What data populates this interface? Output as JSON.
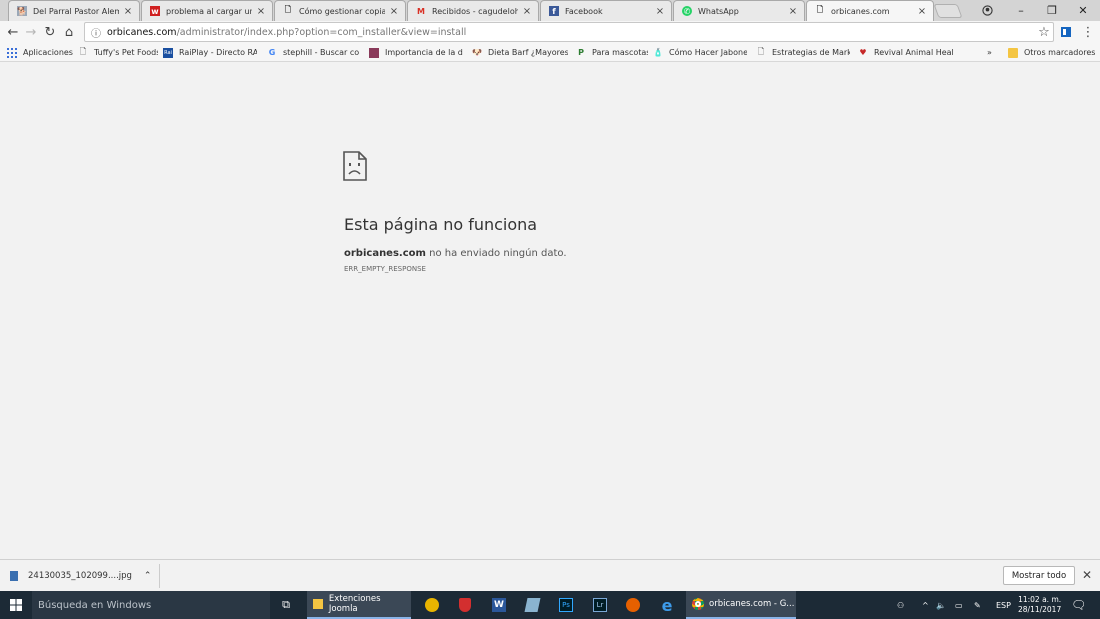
{
  "tabs": [
    {
      "title": "Del Parral Pastor Alemán",
      "icon": "dog-icon",
      "active": false
    },
    {
      "title": "problema al cargar un m",
      "icon": "w-icon",
      "active": false
    },
    {
      "title": "Cómo gestionar copias d",
      "icon": "page-icon",
      "active": false
    },
    {
      "title": "Recibidos - cagudeloh@",
      "icon": "gmail-icon",
      "active": false
    },
    {
      "title": "Facebook",
      "icon": "facebook-icon",
      "active": false
    },
    {
      "title": "WhatsApp",
      "icon": "whatsapp-icon",
      "active": false
    },
    {
      "title": "orbicanes.com",
      "icon": "page-icon",
      "active": true
    }
  ],
  "omnibox": {
    "host": "orbicanes.com",
    "path": "/administrator/index.php?option=com_installer&view=install"
  },
  "bookmarks": {
    "apps_label": "Aplicaciones",
    "items": [
      {
        "label": "Tuffy's Pet Foods",
        "icon": "page-icon"
      },
      {
        "label": "RaiPlay - Directo RAI",
        "icon": "raiplay-icon"
      },
      {
        "label": "stephill - Buscar con",
        "icon": "google-icon"
      },
      {
        "label": "Importancia de la die",
        "icon": "bookmark-image-icon"
      },
      {
        "label": "Dieta Barf ¿Mayores",
        "icon": "dog-face-icon"
      },
      {
        "label": "Para mascotas",
        "icon": "p-icon"
      },
      {
        "label": "Cómo Hacer Jabones",
        "icon": "bottle-icon"
      },
      {
        "label": "Estrategias de Marke",
        "icon": "page-icon"
      },
      {
        "label": "Revival Animal Health",
        "icon": "heart-icon"
      }
    ],
    "overflow": "»",
    "other_label": "Otros marcadores"
  },
  "error": {
    "title": "Esta página no funciona",
    "host": "orbicanes.com",
    "message": " no ha enviado ningún dato.",
    "code": "ERR_EMPTY_RESPONSE"
  },
  "downloads": {
    "file": "24130035_102099....jpg",
    "show_all": "Mostrar todo"
  },
  "taskbar": {
    "search_placeholder": "Búsqueda en Windows",
    "apps": [
      {
        "label": "Extenciones Joomla",
        "icon": "folder-icon"
      },
      {
        "label": "orbicanes.com - G...",
        "icon": "chrome-icon"
      }
    ],
    "lang": "ESP",
    "time": "11:02 a. m.",
    "date": "28/11/2017"
  },
  "colors": {
    "taskbar": "#1c2a36",
    "page_bg": "#f2f2f2",
    "accent": "#8ab4e8"
  }
}
